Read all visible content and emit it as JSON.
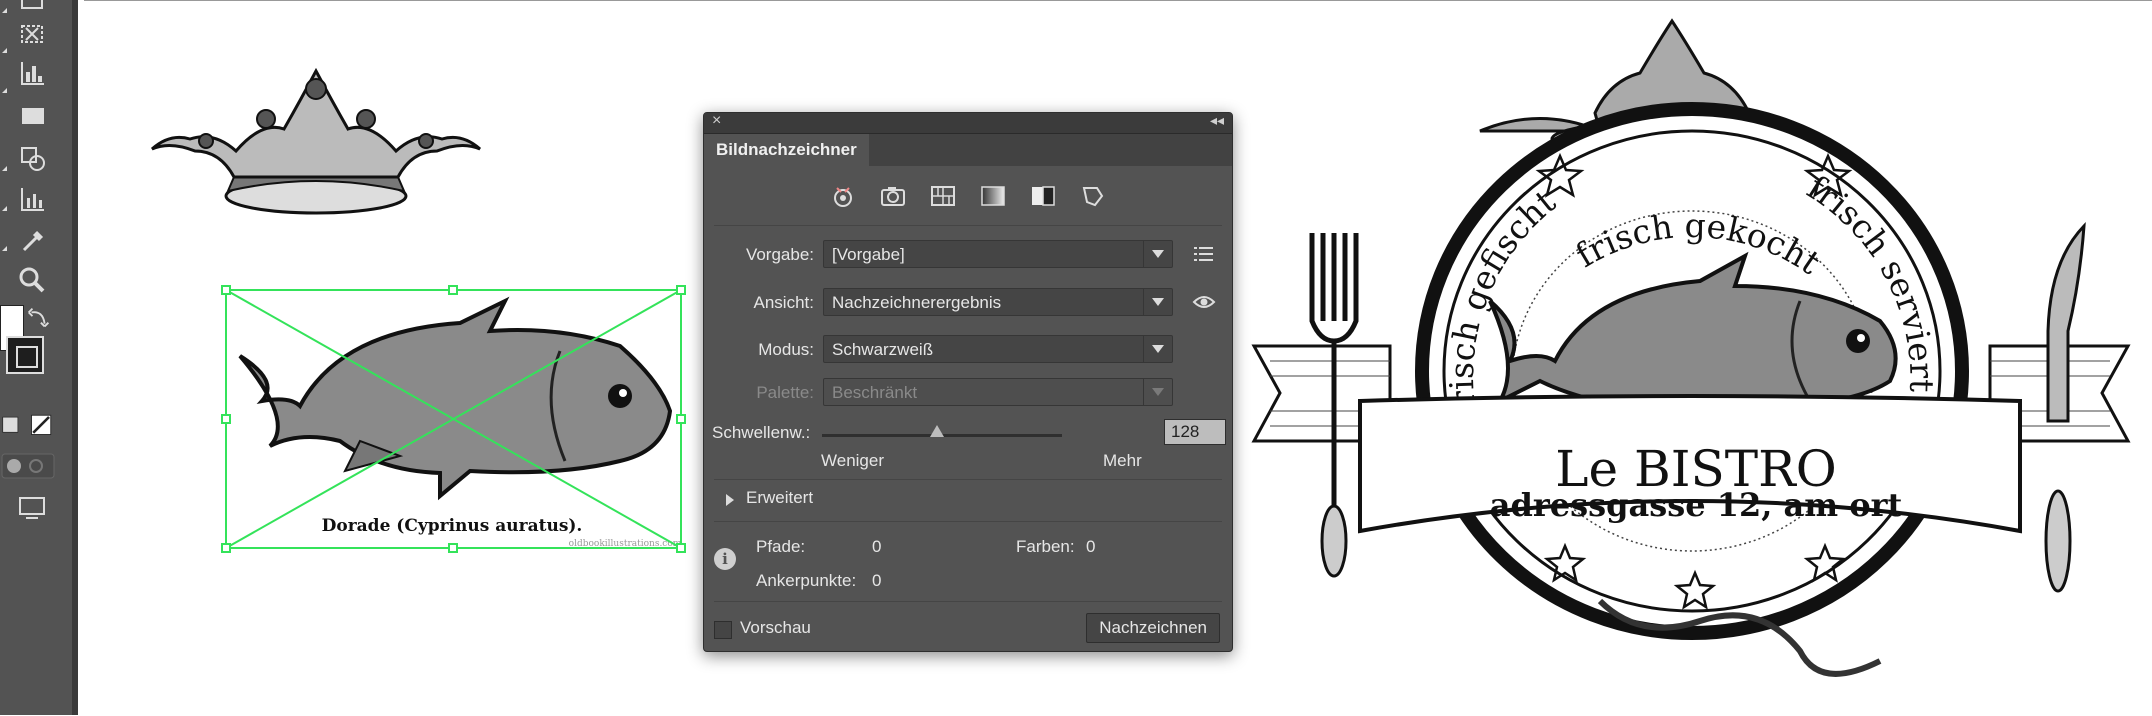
{
  "dialog": {
    "tab_title": "Bildnachzeichner",
    "preset_icons": [
      "auto-color-icon",
      "high-color-photo-icon",
      "low-color-icon",
      "grayscale-icon",
      "black-white-icon",
      "outline-icon"
    ],
    "vorgabe_label": "Vorgabe:",
    "vorgabe_value": "[Vorgabe]",
    "ansicht_label": "Ansicht:",
    "ansicht_value": "Nachzeichnerergebnis",
    "modus_label": "Modus:",
    "modus_value": "Schwarzweiß",
    "palette_label": "Palette:",
    "palette_value": "Beschränkt",
    "threshold_label": "Schwellenw.:",
    "threshold_value": "128",
    "threshold_fraction": 0.48,
    "less_label": "Weniger",
    "more_label": "Mehr",
    "advanced_label": "Erweitert",
    "paths_label": "Pfade:",
    "paths_value": "0",
    "colors_label": "Farben:",
    "colors_value": "0",
    "anchors_label": "Ankerpunkte:",
    "anchors_value": "0",
    "preview_label": "Vorschau",
    "trace_button": "Nachzeichnen"
  },
  "artwork": {
    "fish_caption": "Dorade (Cyprinus auratus).",
    "watermark": "oldbookillustrations.com",
    "logo_arc_left": "frisch gefischt",
    "logo_arc_top": "frisch gekocht",
    "logo_arc_right": "frisch serviert",
    "logo_name": "Le BISTRO",
    "logo_address": "adressgasse 12, am ort"
  },
  "colors": {
    "selection": "#34e35a",
    "panel": "#535353",
    "toolbar": "#535353"
  }
}
